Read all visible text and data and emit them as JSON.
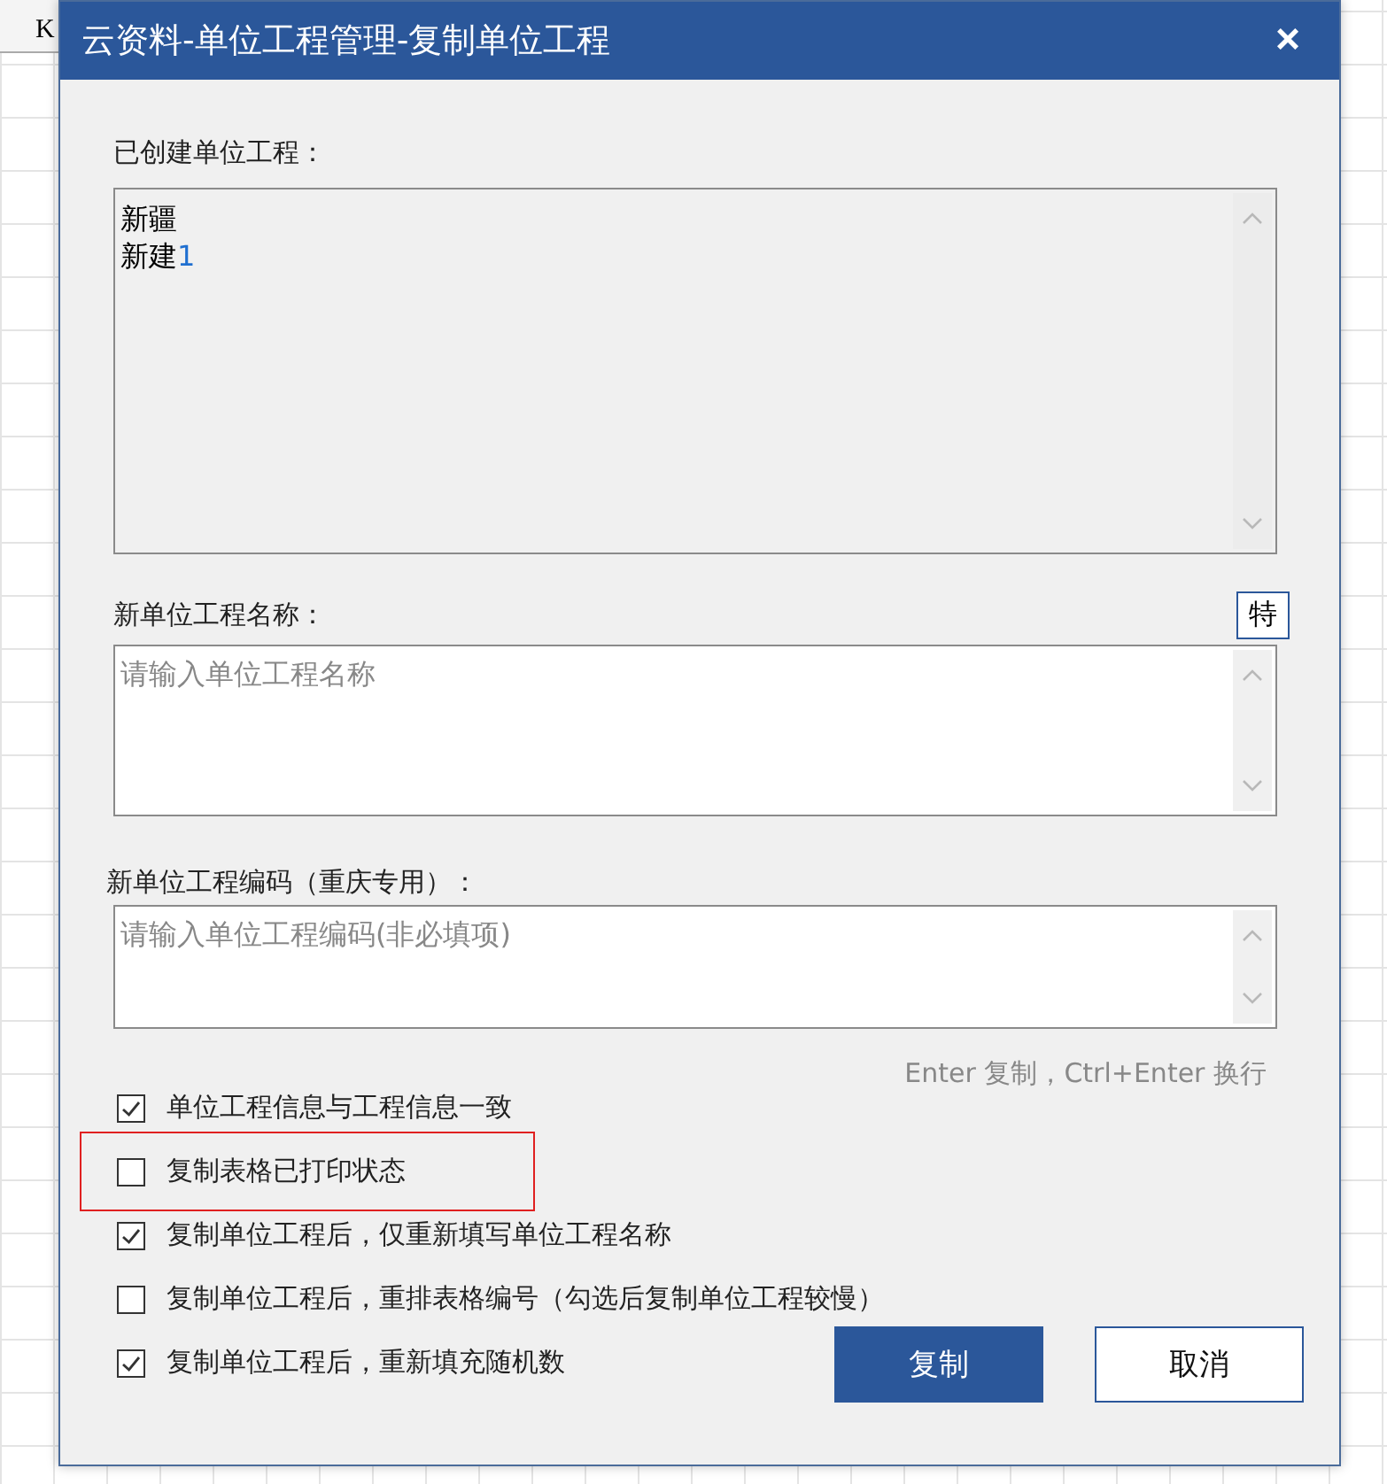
{
  "sheet": {
    "column_header": "K"
  },
  "window": {
    "title": "云资料-单位工程管理-复制单位工程",
    "close": "×"
  },
  "created_list": {
    "label": "已创建单位工程：",
    "items": [
      {
        "name": "新疆"
      },
      {
        "name": "新建",
        "suffix": "1"
      }
    ]
  },
  "name_field": {
    "label": "新单位工程名称：",
    "special_button": "特",
    "placeholder": "请输入单位工程名称"
  },
  "code_field": {
    "label": "新单位工程编码（重庆专用）：",
    "placeholder": "请输入单位工程编码(非必填项)"
  },
  "hint": "Enter 复制，Ctrl+Enter 换行",
  "options": [
    {
      "label": "单位工程信息与工程信息一致",
      "checked": true,
      "highlighted": false
    },
    {
      "label": "复制表格已打印状态",
      "checked": false,
      "highlighted": true
    },
    {
      "label": "复制单位工程后，仅重新填写单位工程名称",
      "checked": true,
      "highlighted": false
    },
    {
      "label": "复制单位工程后，重排表格编号（勾选后复制单位工程较慢）",
      "checked": false,
      "highlighted": false
    },
    {
      "label": "复制单位工程后，重新填充随机数",
      "checked": true,
      "highlighted": false
    }
  ],
  "buttons": [
    {
      "label": "复制",
      "kind": "primary"
    },
    {
      "label": "取消",
      "kind": "secondary"
    }
  ]
}
